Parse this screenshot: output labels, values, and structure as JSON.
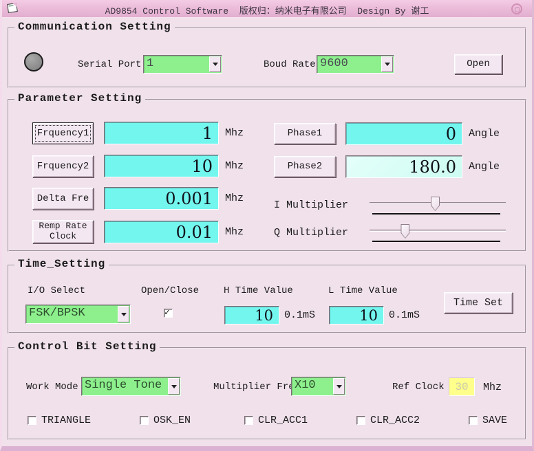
{
  "window": {
    "title": "AD9854 Control Software  版权归：纳米电子有限公司  Design By 谢工"
  },
  "colors": {
    "titlebar_pink": "#ecbcda",
    "body_pink": "#f0e1eb",
    "combo_green": "#8df08d",
    "field_cyan": "#72f6ee",
    "field_lightcyan": "#d9fdf4",
    "field_yellow": "#ffff8c",
    "led_gray": "#8a8a8a"
  },
  "communication": {
    "heading": "Communication Setting",
    "serial_port_label": "Serial Port",
    "serial_port_value": "1",
    "baud_rate_label": "Boud Rate",
    "baud_rate_value": "9600",
    "open_button": "Open"
  },
  "parameter": {
    "heading": "Parameter Setting",
    "freq_rows": [
      {
        "label": "Frquency1",
        "value": "1",
        "unit": "Mhz"
      },
      {
        "label": "Frquency2",
        "value": "10",
        "unit": "Mhz"
      },
      {
        "label": "Delta Fre",
        "value": "0.001",
        "unit": "Mhz"
      },
      {
        "label": "Remp Rate Clock",
        "value": "0.01",
        "unit": "Mhz"
      }
    ],
    "phase_rows": [
      {
        "label": "Phase1",
        "value": "0",
        "unit": "Angle"
      },
      {
        "label": "Phase2",
        "value": "180.0",
        "unit": "Angle"
      }
    ],
    "sliders": [
      {
        "label": "I Multiplier",
        "percent": 48
      },
      {
        "label": "Q Multiplier",
        "percent": 26
      }
    ]
  },
  "time": {
    "heading": "Time_Setting",
    "io_select_label": "I/O Select",
    "io_select_value": "FSK/BPSK",
    "open_close_label": "Open/Close",
    "open_close_checked": true,
    "h_time_label": "H Time Value",
    "h_time_value": "10",
    "h_time_unit": "0.1mS",
    "l_time_label": "L Time Value",
    "l_time_value": "10",
    "l_time_unit": "0.1mS",
    "time_set_button": "Time Set"
  },
  "control": {
    "heading": "Control Bit Setting",
    "work_mode_label": "Work Mode",
    "work_mode_value": "Single Tone",
    "multiplier_label": "Multiplier Fre",
    "multiplier_value": "X10",
    "ref_clock_label": "Ref Clock",
    "ref_clock_value": "30",
    "ref_clock_unit": "Mhz",
    "checkboxes": [
      {
        "label": "TRIANGLE",
        "checked": false
      },
      {
        "label": "OSK_EN",
        "checked": false
      },
      {
        "label": "CLR_ACC1",
        "checked": false
      },
      {
        "label": "CLR_ACC2",
        "checked": false
      },
      {
        "label": "SAVE",
        "checked": false
      }
    ]
  }
}
